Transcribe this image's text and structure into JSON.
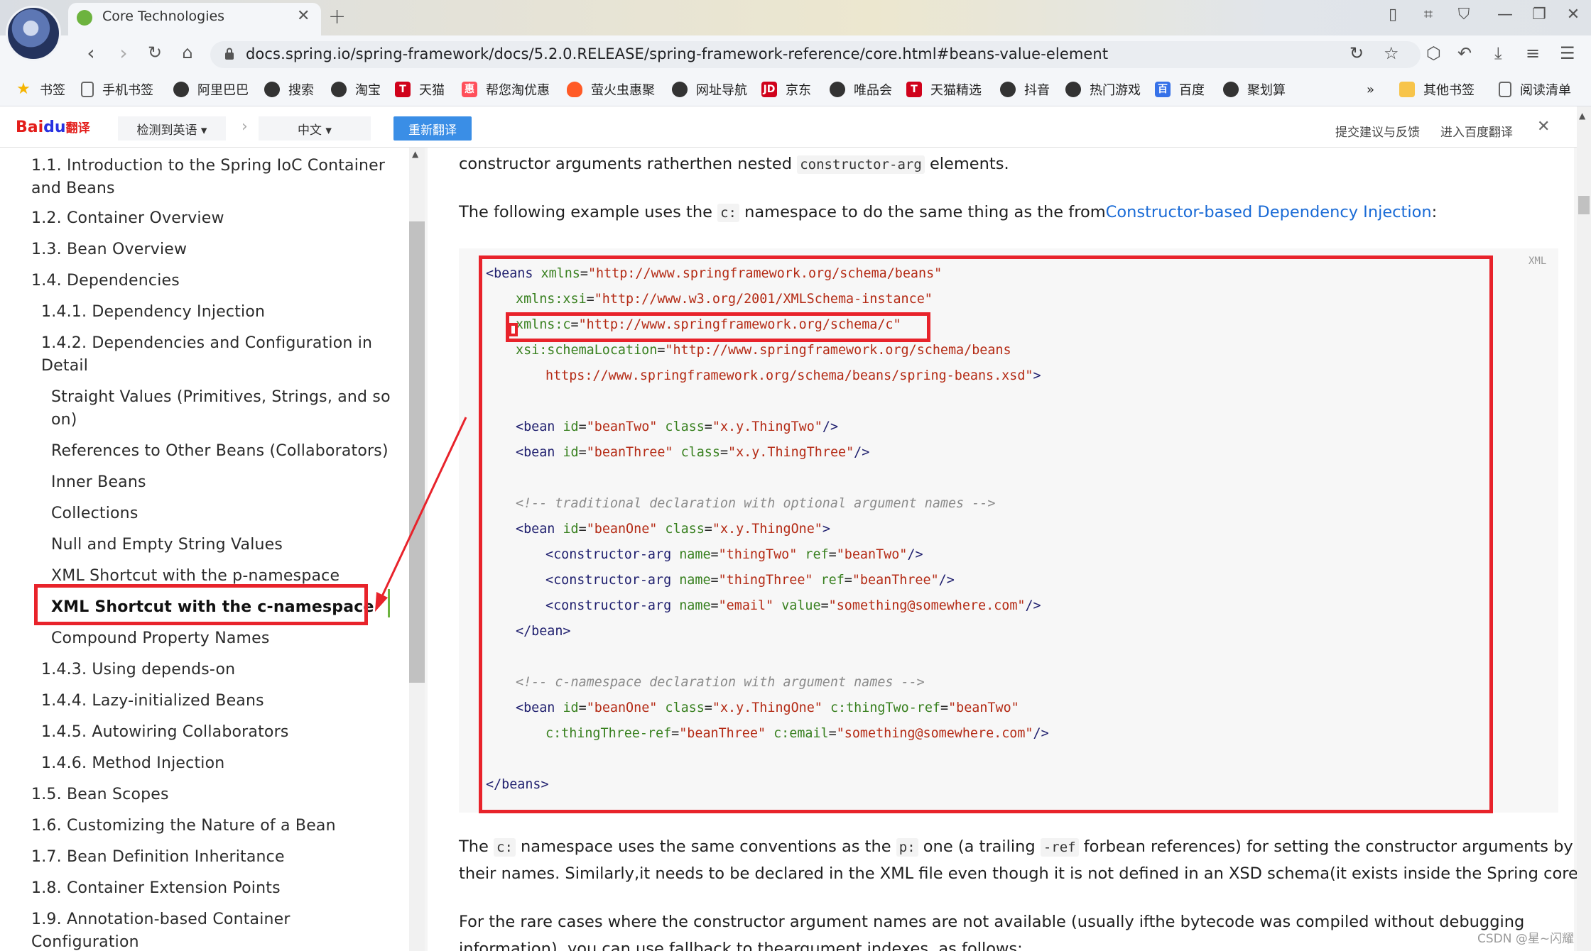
{
  "browser": {
    "tab_title": "Core Technologies",
    "url": "docs.spring.io/spring-framework/docs/5.2.0.RELEASE/spring-framework-reference/core.html#beans-value-element",
    "icons": {
      "back": "back-arrow-icon",
      "forward": "forward-arrow-icon",
      "reload": "reload-icon",
      "home": "home-icon",
      "lock": "lock-icon",
      "share": "share-icon",
      "star": "star-icon"
    }
  },
  "bookmarks": [
    {
      "label": "书签",
      "icon": "star",
      "glyph": "★"
    },
    {
      "label": "手机书签",
      "icon": "doc",
      "glyph": ""
    },
    {
      "label": "阿里巴巴",
      "icon": "circle",
      "glyph": ""
    },
    {
      "label": "搜索",
      "icon": "circle",
      "glyph": ""
    },
    {
      "label": "淘宝",
      "icon": "circle",
      "glyph": ""
    },
    {
      "label": "天猫",
      "icon": "red",
      "glyph": "T"
    },
    {
      "label": "帮您淘优惠",
      "icon": "pink",
      "glyph": "惠"
    },
    {
      "label": "萤火虫惠聚",
      "icon": "fire",
      "glyph": ""
    },
    {
      "label": "网址导航",
      "icon": "circle",
      "glyph": ""
    },
    {
      "label": "京东",
      "icon": "red",
      "glyph": "JD"
    },
    {
      "label": "唯品会",
      "icon": "circle",
      "glyph": ""
    },
    {
      "label": "天猫精选",
      "icon": "red",
      "glyph": "T"
    },
    {
      "label": "抖音",
      "icon": "circle",
      "glyph": ""
    },
    {
      "label": "热门游戏",
      "icon": "circle",
      "glyph": ""
    },
    {
      "label": "百度",
      "icon": "blue",
      "glyph": "百"
    },
    {
      "label": "聚划算",
      "icon": "circle",
      "glyph": ""
    },
    {
      "label": "»",
      "icon": "none",
      "glyph": ""
    },
    {
      "label": "其他书签",
      "icon": "folder",
      "glyph": ""
    },
    {
      "label": "阅读清单",
      "icon": "doc",
      "glyph": ""
    }
  ],
  "translate_bar": {
    "logo_text": "Bai",
    "logo_paw": "du",
    "logo_suffix": "翻译",
    "source_lang": "检测到英语 ▾",
    "arrow": "›",
    "target_lang": "中文 ▾",
    "retranslate": "重新翻译",
    "feedback": "提交建议与反馈",
    "open_baidu": "进入百度翻译",
    "close": "✕"
  },
  "sidebar": {
    "items": [
      {
        "label": "1.1. Introduction to the Spring IoC Container"
      },
      {
        "label": "and Beans"
      },
      {
        "label": "1.2. Container Overview"
      },
      {
        "label": "1.3. Bean Overview"
      },
      {
        "label": "1.4. Dependencies"
      },
      {
        "label": "1.4.1. Dependency Injection"
      },
      {
        "label": "1.4.2. Dependencies and Configuration in"
      },
      {
        "label": "Detail"
      },
      {
        "label": "Straight Values (Primitives, Strings, and so"
      },
      {
        "label": "on)"
      },
      {
        "label": "References to Other Beans (Collaborators)"
      },
      {
        "label": "Inner Beans"
      },
      {
        "label": "Collections"
      },
      {
        "label": "Null and Empty String Values"
      },
      {
        "label": "XML Shortcut with the p-namespace"
      },
      {
        "label": "XML Shortcut with the c-namespace"
      },
      {
        "label": "Compound Property Names"
      },
      {
        "label": "1.4.3. Using depends-on"
      },
      {
        "label": "1.4.4. Lazy-initialized Beans"
      },
      {
        "label": "1.4.5. Autowiring Collaborators"
      },
      {
        "label": "1.4.6. Method Injection"
      },
      {
        "label": "1.5. Bean Scopes"
      },
      {
        "label": "1.6. Customizing the Nature of a Bean"
      },
      {
        "label": "1.7. Bean Definition Inheritance"
      },
      {
        "label": "1.8. Container Extension Points"
      },
      {
        "label": "1.9. Annotation-based Container"
      },
      {
        "label": "Configuration"
      }
    ]
  },
  "content": {
    "p1_before": "constructor arguments ratherthen nested ",
    "p1_code": "constructor-arg",
    "p1_after": " elements.",
    "p2_before": "The following example uses the ",
    "p2_code": "c:",
    "p2_mid": " namespace to do the same thing as the from",
    "p2_link": "Constructor-based Dependency Injection",
    "p2_after": ":",
    "code_lang": "XML",
    "p3_a": "The ",
    "p3_code1": "c:",
    "p3_b": " namespace uses the same conventions as the ",
    "p3_code2": "p:",
    "p3_c": " one (a trailing ",
    "p3_code3": "-ref",
    "p3_d": " forbean references) for setting the constructor arguments by",
    "p3_line2": "their names. Similarly,it needs to be declared in the XML file even though it is not defined in an XSD schema(it exists inside the Spring core).",
    "p4_line1": "For the rare cases where the constructor argument names are not available (usually ifthe bytecode was compiled without debugging",
    "p4_line2": "information), you can use fallback to theargument indexes, as follows:"
  },
  "code": {
    "l1_tag": "<beans",
    "l1_attr": "xmlns",
    "l1_val": "\"http://www.springframework.org/schema/beans\"",
    "l2_attr": "xmlns:xsi",
    "l2_val": "\"http://www.w3.org/2001/XMLSchema-instance\"",
    "l3_attr": "xmlns:c",
    "l3_val": "\"http://www.springframework.org/schema/c\"",
    "l4_attr": "xsi:schemaLocation",
    "l4_val": "\"http://www.springframework.org/schema/beans",
    "l5_val": "https://www.springframework.org/schema/beans/spring-beans.xsd\"",
    "l5_end": ">",
    "l6_tag": "<bean",
    "l6_a1": "id",
    "l6_v1": "\"beanTwo\"",
    "l6_a2": "class",
    "l6_v2": "\"x.y.ThingTwo\"",
    "l6_end": "/>",
    "l7_tag": "<bean",
    "l7_a1": "id",
    "l7_v1": "\"beanThree\"",
    "l7_a2": "class",
    "l7_v2": "\"x.y.ThingThree\"",
    "l7_end": "/>",
    "c1": "<!-- traditional declaration with optional argument names -->",
    "l8_tag": "<bean",
    "l8_a1": "id",
    "l8_v1": "\"beanOne\"",
    "l8_a2": "class",
    "l8_v2": "\"x.y.ThingOne\"",
    "l8_end": ">",
    "l9_tag": "<constructor-arg",
    "l9_a1": "name",
    "l9_v1": "\"thingTwo\"",
    "l9_a2": "ref",
    "l9_v2": "\"beanTwo\"",
    "l9_end": "/>",
    "l10_tag": "<constructor-arg",
    "l10_a1": "name",
    "l10_v1": "\"thingThree\"",
    "l10_a2": "ref",
    "l10_v2": "\"beanThree\"",
    "l10_end": "/>",
    "l11_tag": "<constructor-arg",
    "l11_a1": "name",
    "l11_v1": "\"email\"",
    "l11_a2": "value",
    "l11_v2": "\"something@somewhere.com\"",
    "l11_end": "/>",
    "l12": "</bean>",
    "c2": "<!-- c-namespace declaration with argument names -->",
    "l13_tag": "<bean",
    "l13_a1": "id",
    "l13_v1": "\"beanOne\"",
    "l13_a2": "class",
    "l13_v2": "\"x.y.ThingOne\"",
    "l13_a3": "c:thingTwo-ref",
    "l13_v3": "\"beanTwo\"",
    "l14_a1": "c:thingThree-ref",
    "l14_v1": "\"beanThree\"",
    "l14_a2": "c:email",
    "l14_v2": "\"something@somewhere.com\"",
    "l14_end": "/>",
    "l15": "</beans>"
  },
  "watermark": "CSDN @星~闪耀",
  "colors": {
    "highlight": "#e8232b",
    "link": "#1a6bd6",
    "spring_green": "#6db33f",
    "translate_button": "#3a8ee6"
  }
}
